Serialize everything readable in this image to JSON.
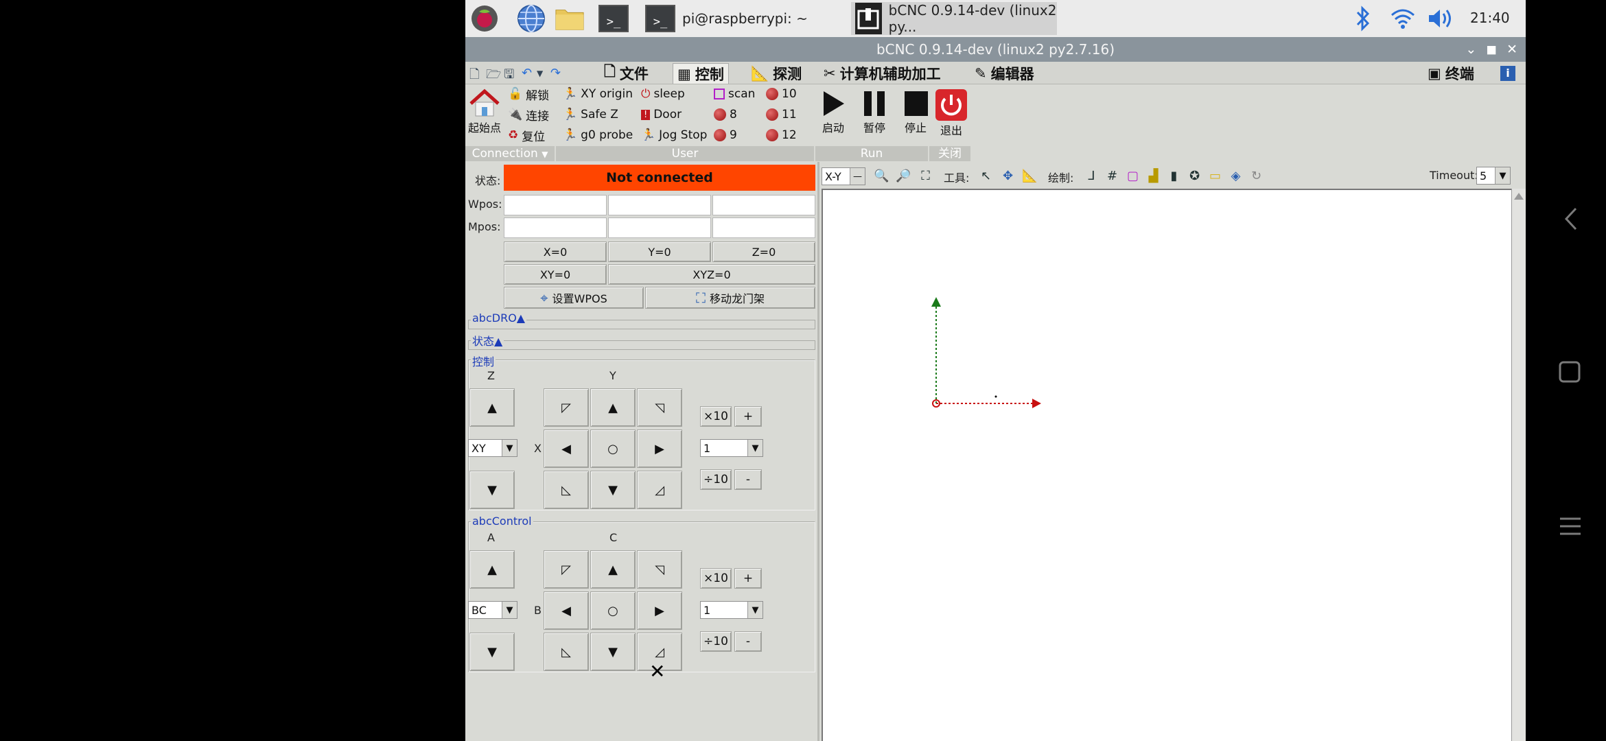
{
  "taskbar": {
    "window_buttons": [
      {
        "label": "pi@raspberrypi: ~"
      },
      {
        "label": "bCNC 0.9.14-dev (linux2 py..."
      }
    ],
    "clock": "21:40",
    "terminal_glyph": ">_"
  },
  "window": {
    "title": "bCNC 0.9.14-dev (linux2 py2.7.16)"
  },
  "menu": {
    "tabs": [
      {
        "label": "文件"
      },
      {
        "label": "控制"
      },
      {
        "label": "探测"
      },
      {
        "label": "计算机辅助加工"
      },
      {
        "label": "编辑器"
      }
    ],
    "terminal_label": "终端",
    "active_tab": "控制"
  },
  "ribbon": {
    "home_label": "起始点",
    "unlock_label": "解锁",
    "connect_label": "连接",
    "reset_label": "复位",
    "user_buttons": [
      "XY origin",
      "Safe Z",
      "g0 probe",
      "sleep",
      "Door",
      "Jog Stop",
      "scan",
      "8",
      "9",
      "10",
      "11",
      "12"
    ],
    "run": {
      "start": "启动",
      "pause": "暂停",
      "stop": "停止"
    },
    "exit_label": "退出",
    "groups": {
      "connection": "Connection",
      "user": "User",
      "run": "Run",
      "close": "关闭"
    }
  },
  "state_panel": {
    "state_label": "状态:",
    "status": "Not connected",
    "wpos_label": "Wpos:",
    "mpos_label": "Mpos:",
    "x0": "X=0",
    "y0": "Y=0",
    "z0": "Z=0",
    "xy0": "XY=0",
    "xyz0": "XYZ=0",
    "set_wpos": "设置WPOS",
    "move_gantry": "移动龙门架",
    "status_color": "#ff4500"
  },
  "sections": {
    "dro": "abcDRO▲",
    "state": "状态▲",
    "control": "控制",
    "abc_control": "abcControl"
  },
  "jog": {
    "z_label": "Z",
    "y_label": "Y",
    "x_label": "X",
    "plane_value": "XY",
    "step_value": "1",
    "times10": "×10",
    "div10": "÷10",
    "plus": "+",
    "minus": "-"
  },
  "abc_jog": {
    "a_label": "A",
    "c_label": "C",
    "b_label": "B",
    "plane_value": "BC",
    "step_value": "1",
    "times10": "×10",
    "div10": "÷10",
    "plus": "+",
    "minus": "-"
  },
  "canvas_toolbar": {
    "view_value": "X-Y",
    "tools_label": "工具:",
    "draw_label": "绘制:",
    "timeout_label": "Timeout:",
    "timeout_value": "5"
  }
}
